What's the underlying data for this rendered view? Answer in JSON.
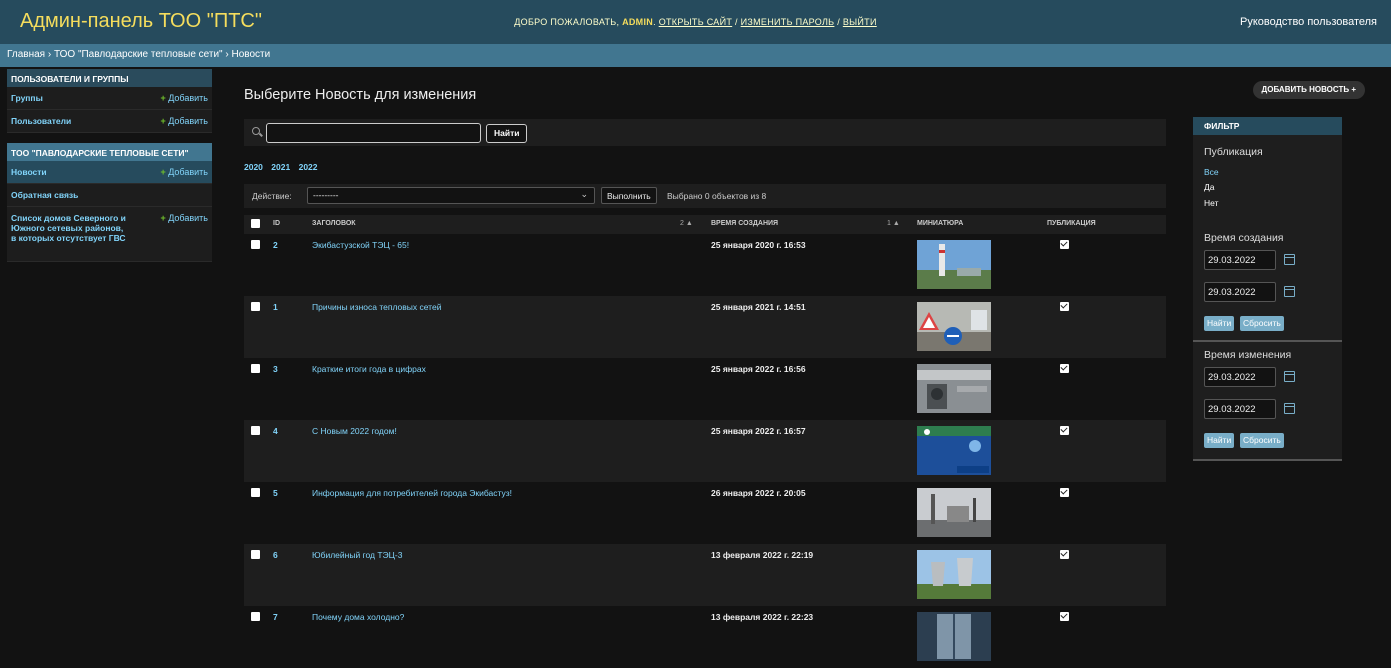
{
  "header": {
    "site_name": "Админ-панель ТОО \"ПТС\"",
    "welcome": "ДОБРО ПОЖАЛОВАТЬ,",
    "username": "ADMIN",
    "view_site": "ОТКРЫТЬ САЙТ",
    "change_password": "ИЗМЕНИТЬ ПАРОЛЬ",
    "logout": "ВЫЙТИ",
    "sep": "/",
    "manual": "Руководство пользователя"
  },
  "breadcrumbs": "Главная › ТОО \"Павлодарские тепловые сети\" › Новости",
  "sidebar": {
    "groups": [
      {
        "caption": "ПОЛЬЗОВАТЕЛИ И ГРУППЫ",
        "items": [
          {
            "label": "Группы",
            "add": "Добавить"
          },
          {
            "label": "Пользователи",
            "add": "Добавить"
          }
        ]
      },
      {
        "caption": "ТОО \"ПАВЛОДАРСКИЕ ТЕПЛОВЫЕ СЕТИ\"",
        "items": [
          {
            "label": "Новости",
            "add": "Добавить"
          },
          {
            "label": "Обратная связь",
            "add": ""
          },
          {
            "label": "Список домов Северного и Южного сетевых районов, в которых отсутствует ГВС",
            "add": "Добавить"
          }
        ]
      }
    ],
    "add_plus": "+"
  },
  "content": {
    "title": "Выберите Новость для изменения",
    "add_button": "ДОБАВИТЬ НОВОСТЬ",
    "add_icon": "+"
  },
  "search": {
    "value": "",
    "placeholder": "",
    "button": "Найти"
  },
  "date_hierarchy": [
    "2020",
    "2021",
    "2022"
  ],
  "actions": {
    "label": "Действие:",
    "selected": "---------",
    "go": "Выполнить",
    "counter": "Выбрано 0 объектов из 8"
  },
  "table": {
    "columns": {
      "id": "ID",
      "title": "ЗАГОЛОВОК",
      "created_sort": "2 ▲",
      "created": "ВРЕМЯ СОЗДАНИЯ",
      "thumb_sort": "1 ▲",
      "thumb": "МИНИАТЮРА",
      "published": "ПУБЛИКАЦИЯ"
    },
    "rows": [
      {
        "id": "2",
        "title": "Экибастузской ТЭЦ - 65!",
        "created": "25 января 2020 г. 16:53",
        "thumb": "chimney",
        "published": true
      },
      {
        "id": "1",
        "title": "Причины износа тепловых сетей",
        "created": "25 января 2021 г. 14:51",
        "thumb": "roadworks",
        "published": true
      },
      {
        "id": "3",
        "title": "Краткие итоги года в цифрах",
        "created": "25 января 2022 г. 16:56",
        "thumb": "pipes",
        "published": true
      },
      {
        "id": "4",
        "title": "С Новым 2022 годом!",
        "created": "25 января 2022 г. 16:57",
        "thumb": "new-year",
        "published": true
      },
      {
        "id": "5",
        "title": "Информация для потребителей города Экибастуз!",
        "created": "26 января 2022 г. 20:05",
        "thumb": "plant",
        "published": true
      },
      {
        "id": "6",
        "title": "Юбилейный год ТЭЦ-3",
        "created": "13 февраля 2022 г. 22:19",
        "thumb": "cooling-towers",
        "published": true
      },
      {
        "id": "7",
        "title": "Почему дома холодно?",
        "created": "13 февраля 2022 г. 22:23",
        "thumb": "window",
        "published": true
      }
    ]
  },
  "filter": {
    "title": "ФИЛЬТР",
    "publication": {
      "title": "Публикация",
      "options": [
        "Все",
        "Да",
        "Нет"
      ],
      "selected": "Все"
    },
    "created": {
      "title": "Время создания",
      "from": "29.03.2022",
      "to": "29.03.2022",
      "search": "Найти",
      "reset": "Сбросить"
    },
    "changed": {
      "title": "Время изменения",
      "from": "29.03.2022",
      "to": "29.03.2022",
      "search": "Найти",
      "reset": "Сбросить"
    }
  },
  "colors": {
    "header_bg": "#264b5d",
    "breadcrumbs_bg": "#417690",
    "link": "#81d4fa",
    "site_name": "#f5dd5d",
    "add_plus": "#70bf2b",
    "page_bg": "#121212"
  }
}
